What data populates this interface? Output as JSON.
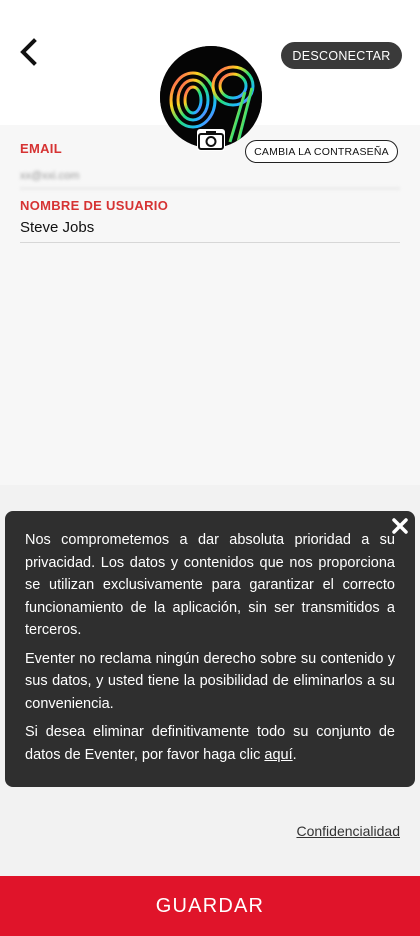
{
  "header": {
    "back_icon": "chevron-left-icon",
    "disconnect_label": "DESCONECTAR",
    "avatar_icon": "colorful-09-logo-avatar",
    "camera_icon": "camera-icon",
    "change_password_label": "CAMBIA LA CONTRASEÑA"
  },
  "form": {
    "email_label": "EMAIL",
    "email_value": "xx@xxi.com",
    "username_label": "NOMBRE DE USUARIO",
    "username_value": "Steve Jobs"
  },
  "privacy": {
    "close_icon": "close-icon",
    "paragraph_1": "Nos comprometemos a dar absoluta prioridad a su privacidad. Los datos y contenidos que nos proporciona se utilizan exclusivamente para garantizar el correcto funcionamiento de la aplicación, sin ser transmitidos a terceros.",
    "paragraph_2": "Eventer no reclama ningún derecho sobre su contenido y sus datos, y usted tiene la posibilidad de eliminarlos a su conveniencia.",
    "paragraph_3": "Si desea eliminar definitivamente todo su conjunto de datos de Eventer, por favor haga clic",
    "link_label": "aquí",
    "link_suffix": "."
  },
  "footer": {
    "confidentiality_label": "Confidencialidad",
    "save_label": "GUARDAR"
  },
  "colors": {
    "accent_red": "#e0142a",
    "label_red": "#d63333",
    "dark_button": "#3a3a3a",
    "card_bg": "#2f2f2f"
  }
}
